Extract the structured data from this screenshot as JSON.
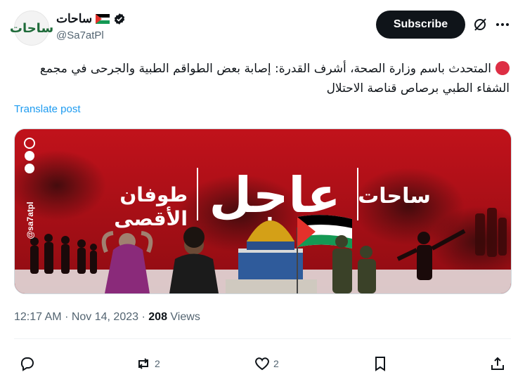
{
  "author": {
    "display_name": "ساحات",
    "handle": "@Sa7atPl",
    "avatar_text": "ساحات",
    "flag_icon": "palestine-flag-icon",
    "verified_icon": "verified-badge-icon"
  },
  "header": {
    "subscribe_label": "Subscribe",
    "grok_icon": "grok-icon",
    "more_icon": "more-dots-icon"
  },
  "post": {
    "status_icon": "red-circle-emoji",
    "text": "المتحدث باسم وزارة الصحة، أشرف القدرة: إصابة بعض الطواقم الطبية والجرحى في مجمع الشفاء الطبي برصاص قناصة الاحتلال",
    "translate_label": "Translate post"
  },
  "media": {
    "headline": "عاجل",
    "title_line1": "طوفان",
    "title_line2": "الأقصى",
    "brand_mark": "ساحات",
    "side_handle": "@sa7atpl",
    "colors": {
      "background": "#b3121a",
      "accent": "#d4a017"
    }
  },
  "meta": {
    "time": "12:17 AM",
    "separator": "·",
    "date": "Nov 14, 2023",
    "views_count": "208",
    "views_label": "Views"
  },
  "actions": {
    "reply_count": "",
    "repost_count": "2",
    "like_count": "2",
    "bookmark_count": "",
    "share_count": ""
  }
}
